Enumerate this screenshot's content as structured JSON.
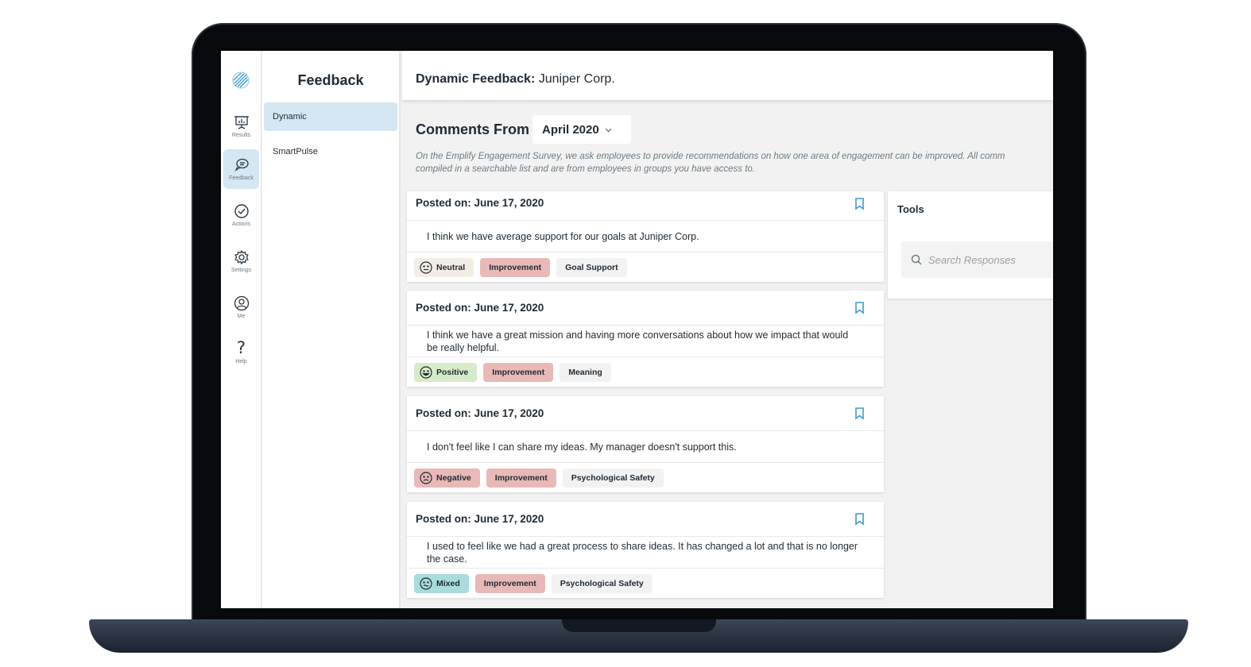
{
  "rail": {
    "items": [
      {
        "label": "Results",
        "icon": "presentation-chart-icon"
      },
      {
        "label": "Feedback",
        "icon": "chat-bubbles-icon"
      },
      {
        "label": "Actions",
        "icon": "check-circle-icon"
      },
      {
        "label": "Settings",
        "icon": "gear-icon"
      },
      {
        "label": "Me",
        "icon": "user-circle-icon"
      },
      {
        "label": "Help",
        "icon": "question-mark-icon"
      }
    ]
  },
  "subnav": {
    "title": "Feedback",
    "items": [
      {
        "label": "Dynamic"
      },
      {
        "label": "SmartPulse"
      }
    ]
  },
  "header": {
    "title_bold": "Dynamic Feedback:",
    "title_rest": " Juniper Corp."
  },
  "comments": {
    "label": "Comments From",
    "month": "April 2020",
    "intro_line1": "On the Emplify Engagement Survey, we ask employees to provide recommendations on how one area of engagement can be improved. All comm",
    "intro_line2": "compiled in a searchable list and are from employees in groups you have access to."
  },
  "cards": [
    {
      "date": "Posted on: June 17, 2020",
      "text": "I think we have average support for our goals at Juniper Corp.",
      "tags": [
        {
          "label": "Neutral",
          "kind": "sentiment",
          "mood": "neutral"
        },
        {
          "label": "Improvement",
          "kind": "type"
        },
        {
          "label": "Goal Support",
          "kind": "topic"
        }
      ]
    },
    {
      "date": "Posted on: June 17, 2020",
      "text": "I think we have a great mission and having more conversations about how we impact that would be really helpful.",
      "tags": [
        {
          "label": "Positive",
          "kind": "sentiment",
          "mood": "positive"
        },
        {
          "label": "Improvement",
          "kind": "type"
        },
        {
          "label": "Meaning",
          "kind": "topic"
        }
      ]
    },
    {
      "date": "Posted on: June 17, 2020",
      "text": "I don't feel like I can share my ideas. My manager doesn't support this.",
      "tags": [
        {
          "label": "Negative",
          "kind": "sentiment",
          "mood": "negative"
        },
        {
          "label": "Improvement",
          "kind": "type"
        },
        {
          "label": "Psychological Safety",
          "kind": "topic"
        }
      ]
    },
    {
      "date": "Posted on: June 17, 2020",
      "text": "I used to feel like we had a great process to share ideas. It has changed a lot and that is no longer the case.",
      "tags": [
        {
          "label": "Mixed",
          "kind": "sentiment",
          "mood": "mixed"
        },
        {
          "label": "Improvement",
          "kind": "type"
        },
        {
          "label": "Psychological Safety",
          "kind": "topic"
        }
      ]
    }
  ],
  "tools": {
    "title": "Tools",
    "search_placeholder": "Search Responses"
  },
  "colors": {
    "accent": "#3a9bd5",
    "nav_active": "#d4e7f3",
    "neutral_tag": "#f3eee5",
    "positive_tag": "#d6ecc8",
    "negative_tag": "#e8b9b7",
    "mixed_tag": "#a9dcdc",
    "improvement_tag": "#e8b9b7",
    "topic_tag": "#f2f2f2"
  }
}
